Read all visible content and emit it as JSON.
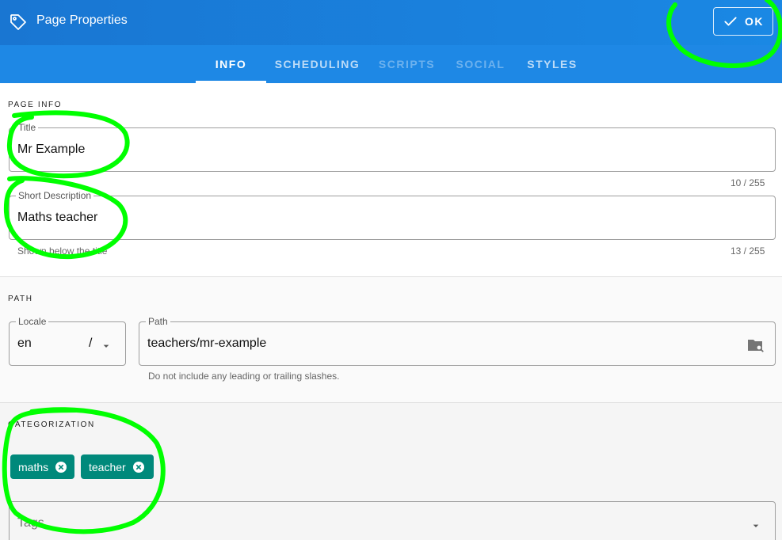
{
  "header": {
    "title": "Page Properties",
    "ok_label": "OK"
  },
  "tabs": [
    {
      "label": "INFO",
      "state": "active"
    },
    {
      "label": "SCHEDULING",
      "state": "enabled"
    },
    {
      "label": "SCRIPTS",
      "state": "disabled"
    },
    {
      "label": "SOCIAL",
      "state": "disabled"
    },
    {
      "label": "STYLES",
      "state": "enabled"
    }
  ],
  "page_info": {
    "section_label": "PAGE INFO",
    "title_field": {
      "label": "Title",
      "value": "Mr Example",
      "counter": "10 / 255"
    },
    "desc_field": {
      "label": "Short Description",
      "value": "Maths teacher",
      "counter": "13 / 255",
      "hint": "Shown below the title"
    }
  },
  "path_section": {
    "section_label": "PATH",
    "locale": {
      "label": "Locale",
      "value": "en",
      "separator": "/"
    },
    "path": {
      "label": "Path",
      "value": "teachers/mr-example",
      "hint": "Do not include any leading or trailing slashes."
    }
  },
  "categorization": {
    "section_label": "CATEGORIZATION",
    "chips": [
      "maths",
      "teacher"
    ],
    "tags_placeholder": "Tags"
  },
  "colors": {
    "header": "#1976d2",
    "tabs": "#1e88e5",
    "chip": "#00897b",
    "annotation": "#00ff00"
  },
  "icons": [
    "tag-icon",
    "check-icon",
    "chevron-down-icon",
    "folder-search-icon",
    "close-circle-icon"
  ]
}
